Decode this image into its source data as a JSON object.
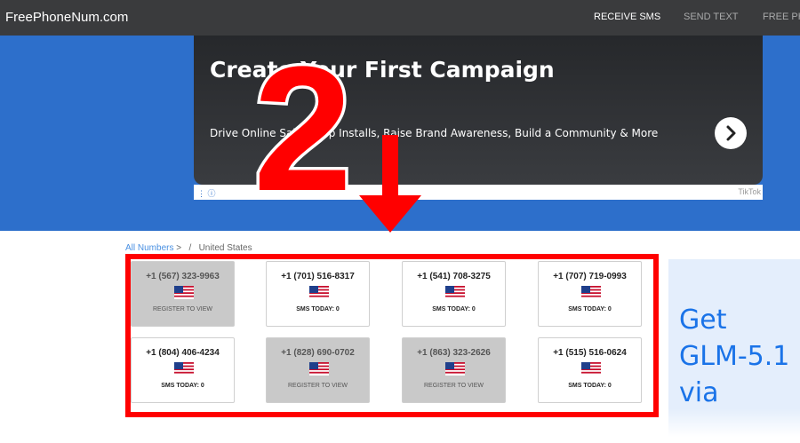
{
  "site": {
    "logo": "FreePhoneNum.com"
  },
  "nav": {
    "items": [
      {
        "label": "RECEIVE SMS",
        "active": true
      },
      {
        "label": "SEND TEXT",
        "active": false
      },
      {
        "label": "FREE PH",
        "active": false
      }
    ]
  },
  "ad": {
    "title": "Create Your First Campaign",
    "description": "Drive Online Sales, App Installs, Raise Brand Awareness, Build a Community & More",
    "brand": "TikTok",
    "info_icon": "info-icon",
    "next_icon": "chevron-right-icon"
  },
  "overlay": {
    "number": "2",
    "arrow_icon": "arrow-down-icon",
    "highlight_color": "#ff0000"
  },
  "breadcrumb": {
    "root": "All Numbers",
    "sep1": ">",
    "sep2": "/",
    "current": "United States"
  },
  "numbers": [
    {
      "phone": "+1 (567) 323-9963",
      "status": "REGISTER TO VIEW",
      "locked": true
    },
    {
      "phone": "+1 (701) 516-8317",
      "status": "SMS TODAY: 0",
      "locked": false
    },
    {
      "phone": "+1 (541) 708-3275",
      "status": "SMS TODAY: 0",
      "locked": false
    },
    {
      "phone": "+1 (707) 719-0993",
      "status": "SMS TODAY: 0",
      "locked": false
    },
    {
      "phone": "+1 (804) 406-4234",
      "status": "SMS TODAY: 0",
      "locked": false
    },
    {
      "phone": "+1 (828) 690-0702",
      "status": "REGISTER TO VIEW",
      "locked": true
    },
    {
      "phone": "+1 (863) 323-2626",
      "status": "REGISTER TO VIEW",
      "locked": true
    },
    {
      "phone": "+1 (515) 516-0624",
      "status": "SMS TODAY: 0",
      "locked": false
    }
  ],
  "side_ad": {
    "line1": "Get",
    "line2": "GLM-5.1",
    "line3": "via"
  },
  "colors": {
    "topbar": "#3a3b3d",
    "hero": "#2d6fcb",
    "link": "#4a90e2",
    "locked_card": "#c9c9c9"
  }
}
